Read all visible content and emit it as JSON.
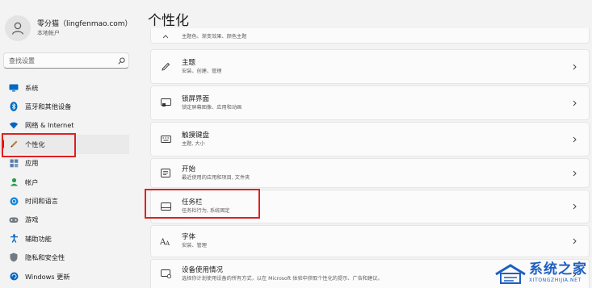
{
  "profile": {
    "name": "零分猫（lingfenmao.com）",
    "type": "本地帐户",
    "avatar_icon": "person-icon"
  },
  "search": {
    "placeholder": "查找设置",
    "icon": "search-icon"
  },
  "nav": {
    "items": [
      {
        "label": "系统",
        "icon": "monitor-icon"
      },
      {
        "label": "蓝牙和其他设备",
        "icon": "bluetooth-icon"
      },
      {
        "label": "网络 & Internet",
        "icon": "wifi-icon"
      },
      {
        "label": "个性化",
        "icon": "pen-icon",
        "active": true
      },
      {
        "label": "应用",
        "icon": "apps-icon"
      },
      {
        "label": "帐户",
        "icon": "account-icon"
      },
      {
        "label": "时间和语言",
        "icon": "globe-clock-icon"
      },
      {
        "label": "游戏",
        "icon": "gamepad-icon"
      },
      {
        "label": "辅助功能",
        "icon": "accessibility-icon"
      },
      {
        "label": "隐私和安全性",
        "icon": "shield-icon"
      },
      {
        "label": "Windows 更新",
        "icon": "update-icon"
      }
    ]
  },
  "main": {
    "title": "个性化",
    "cut_card_sub": "主题色、渐变效果、颜色主题",
    "cards": [
      {
        "title": "主题",
        "sub": "安装、创建、管理",
        "icon": "brush-icon"
      },
      {
        "title": "锁屏界面",
        "sub": "锁定屏幕图像、应用和动画",
        "icon": "lock-screen-icon"
      },
      {
        "title": "触摸键盘",
        "sub": "主题, 大小",
        "icon": "keyboard-icon"
      },
      {
        "title": "开始",
        "sub": "最近使用的应用和项目, 文件夹",
        "icon": "start-icon"
      },
      {
        "title": "任务栏",
        "sub": "任务栏行为, 系统固定",
        "icon": "taskbar-icon"
      },
      {
        "title": "字体",
        "sub": "安装、管理",
        "icon": "font-icon"
      },
      {
        "title": "设备使用情况",
        "sub": "选择你计划使用设备的所有方式，以在 Microsoft 体验中获取个性化的提示、广告和建议。",
        "icon": "device-usage-icon"
      }
    ]
  },
  "watermark": {
    "main": "系统之家",
    "sub": "XITONGZHIJIA.NET"
  },
  "colors": {
    "accent": "#005fb8",
    "highlight": "#e02020",
    "watermark": "#1e5fc0"
  }
}
